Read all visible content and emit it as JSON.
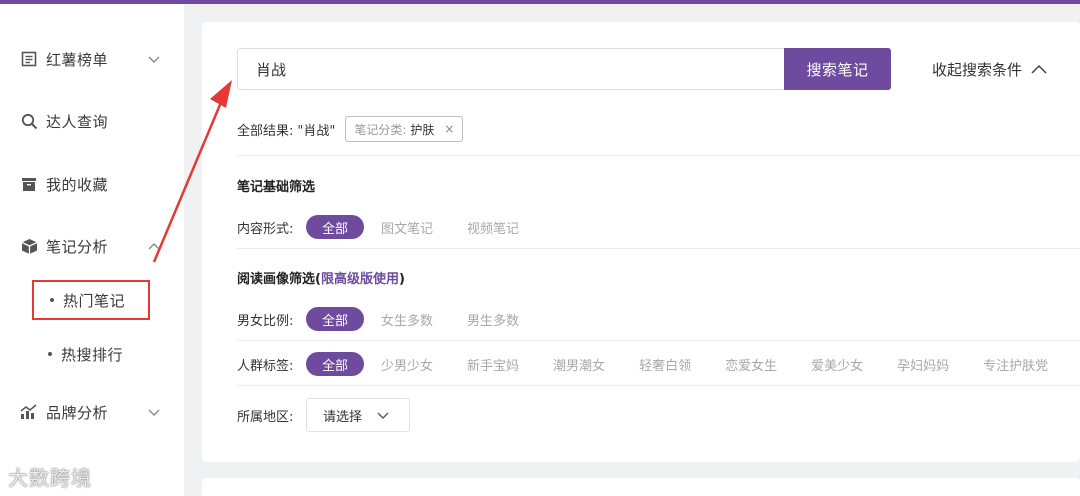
{
  "colors": {
    "accent": "#6e4b9e",
    "highlight_border": "#e53935"
  },
  "sidebar": {
    "items": [
      {
        "label": "红薯榜单",
        "icon": "list-icon"
      },
      {
        "label": "达人查询",
        "icon": "search-icon"
      },
      {
        "label": "我的收藏",
        "icon": "archive-icon"
      },
      {
        "label": "笔记分析",
        "icon": "box-icon"
      },
      {
        "label": "品牌分析",
        "icon": "chart-icon"
      }
    ],
    "sub_items": [
      {
        "label": "热门笔记"
      },
      {
        "label": "热搜排行"
      }
    ],
    "watermark": "大数跨境"
  },
  "search": {
    "value": "肖战",
    "button_label": "搜索笔记",
    "collapse_label": "收起搜索条件"
  },
  "results": {
    "label": "全部结果:",
    "query": "\"肖战\"",
    "tag_key": "笔记分类:",
    "tag_value": "护肤",
    "tag_close": "×"
  },
  "basic_filter": {
    "title": "笔记基础筛选",
    "content_form": {
      "label": "内容形式:",
      "options": [
        "全部",
        "图文笔记",
        "视频笔记"
      ]
    }
  },
  "reader_filter": {
    "title_prefix": "阅读画像筛选(",
    "title_highlight": "限高级版使用",
    "title_suffix": ")",
    "gender": {
      "label": "男女比例:",
      "options": [
        "全部",
        "女生多数",
        "男生多数"
      ]
    },
    "crowd": {
      "label": "人群标签:",
      "options": [
        "全部",
        "少男少女",
        "新手宝妈",
        "潮男潮女",
        "轻奢白领",
        "恋爱女生",
        "爱美少女",
        "孕妇妈妈",
        "专注护肤党"
      ]
    },
    "region": {
      "label": "所属地区:",
      "placeholder": "请选择"
    }
  }
}
